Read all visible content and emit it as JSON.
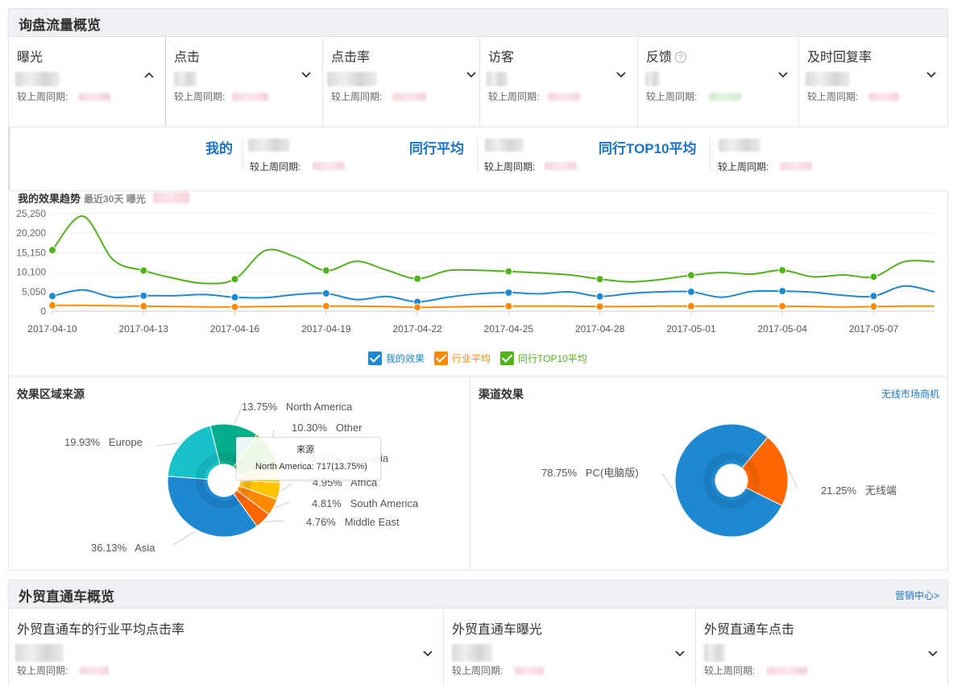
{
  "section1": {
    "title": "询盘流量概览",
    "metrics": [
      {
        "label": "曝光",
        "compare": "较上周同期:",
        "expanded": true
      },
      {
        "label": "点击",
        "compare": "较上周同期:"
      },
      {
        "label": "点击率",
        "compare": "较上周同期:"
      },
      {
        "label": "访客",
        "compare": "较上周同期:"
      },
      {
        "label": "反馈",
        "compare": "较上周同期:",
        "help_icon": "?"
      },
      {
        "label": "及时回复率",
        "compare": "较上周同期:"
      }
    ],
    "chevron_up": "^",
    "chevron_down": "v"
  },
  "comparison": {
    "mine": "我的",
    "peer_avg": "同行平均",
    "peer_top10": "同行TOP10平均",
    "compare": "较上周同期:"
  },
  "trend": {
    "title": "我的效果趋势",
    "subtitle": "最近30天 曝光",
    "legend": [
      {
        "name": "我的效果",
        "color": "#1e88d0"
      },
      {
        "name": "行业平均",
        "color": "#ff8a00"
      },
      {
        "name": "同行TOP10平均",
        "color": "#52b21a"
      }
    ]
  },
  "chart_data": [
    {
      "type": "line",
      "y_ticks": [
        "25,250",
        "20,200",
        "15,150",
        "10,100",
        "5,050",
        "0"
      ],
      "ylim": [
        0,
        25250
      ],
      "x_ticks": [
        "2017-04-10",
        "2017-04-13",
        "2017-04-16",
        "2017-04-19",
        "2017-04-22",
        "2017-04-25",
        "2017-04-28",
        "2017-05-01",
        "2017-05-04",
        "2017-05-07"
      ],
      "x": [
        "2017-04-10",
        "2017-04-11",
        "2017-04-12",
        "2017-04-13",
        "2017-04-14",
        "2017-04-15",
        "2017-04-16",
        "2017-04-17",
        "2017-04-18",
        "2017-04-19",
        "2017-04-20",
        "2017-04-21",
        "2017-04-22",
        "2017-04-23",
        "2017-04-24",
        "2017-04-25",
        "2017-04-26",
        "2017-04-27",
        "2017-04-28",
        "2017-04-29",
        "2017-04-30",
        "2017-05-01",
        "2017-05-02",
        "2017-05-03",
        "2017-05-04",
        "2017-05-05",
        "2017-05-06",
        "2017-05-07",
        "2017-05-08",
        "2017-05-09"
      ],
      "marker_dates": [
        "2017-04-10",
        "2017-04-13",
        "2017-04-16",
        "2017-04-19",
        "2017-04-22",
        "2017-04-25",
        "2017-04-28",
        "2017-05-01",
        "2017-05-04",
        "2017-05-07"
      ],
      "series": [
        {
          "name": "我的效果",
          "color": "#1e88d0",
          "values": [
            3900,
            5500,
            3600,
            4000,
            4000,
            4300,
            3600,
            3500,
            4300,
            4600,
            3000,
            3800,
            2400,
            3600,
            4500,
            4800,
            4500,
            5000,
            3800,
            4600,
            5000,
            5000,
            3600,
            5100,
            5200,
            4900,
            4100,
            3900,
            6500,
            5000
          ]
        },
        {
          "name": "行业平均",
          "color": "#ff8a00",
          "values": [
            1500,
            1500,
            1400,
            1300,
            1200,
            1100,
            1100,
            1200,
            1300,
            1300,
            1300,
            1200,
            1000,
            1100,
            1200,
            1300,
            1300,
            1300,
            1200,
            1200,
            1300,
            1300,
            1300,
            1300,
            1300,
            1200,
            1100,
            1200,
            1300,
            1300
          ]
        },
        {
          "name": "同行TOP10平均",
          "color": "#52b21a",
          "values": [
            15800,
            24600,
            13300,
            10500,
            8500,
            7200,
            8300,
            15700,
            14000,
            10500,
            12900,
            10600,
            8400,
            10500,
            10600,
            10300,
            9900,
            9400,
            8300,
            7600,
            8200,
            9300,
            10000,
            9600,
            10600,
            8900,
            9400,
            8900,
            12800,
            12800
          ]
        }
      ]
    },
    {
      "type": "pie",
      "title": "效果区域来源",
      "slices": [
        {
          "label": "North America",
          "value": 13.75,
          "text": "13.75%",
          "color": "#07ad8a"
        },
        {
          "label": "Other",
          "value": 10.3,
          "text": "10.30%",
          "color": "#52b21a"
        },
        {
          "label": "Oceania",
          "value": 5.37,
          "text": "5.37%",
          "color": "#f4d03f"
        },
        {
          "label": "Africa",
          "value": 4.95,
          "text": "4.95%",
          "color": "#ffc300"
        },
        {
          "label": "South America",
          "value": 4.81,
          "text": "4.81%",
          "color": "#ff8a00"
        },
        {
          "label": "Middle East",
          "value": 4.76,
          "text": "4.76%",
          "color": "#ff6600"
        },
        {
          "label": "Asia",
          "value": 36.13,
          "text": "36.13%",
          "color": "#1e88d0"
        },
        {
          "label": "Europe",
          "value": 19.93,
          "text": "19.93%",
          "color": "#17c3c9"
        }
      ],
      "tooltip": {
        "title": "来源",
        "text": "North America: 717(13.75%)"
      }
    },
    {
      "type": "pie",
      "title": "渠道效果",
      "slices": [
        {
          "label": "无线端",
          "value": 21.25,
          "text": "21.25%",
          "color": "#ff6600"
        },
        {
          "label": "PC(电脑版)",
          "value": 78.75,
          "text": "78.75%",
          "color": "#1e88d0"
        }
      ]
    }
  ],
  "region_title": "效果区域来源",
  "channel": {
    "title": "渠道效果",
    "link": "无线市场商机"
  },
  "section2": {
    "title": "外贸直通车概览",
    "link": "营销中心>",
    "metrics": [
      {
        "label": "外贸直通车的行业平均点击率",
        "compare": "较上周同期:"
      },
      {
        "label": "外贸直通车曝光",
        "compare": "较上周同期:"
      },
      {
        "label": "外贸直通车点击",
        "compare": "较上周同期:"
      }
    ]
  }
}
